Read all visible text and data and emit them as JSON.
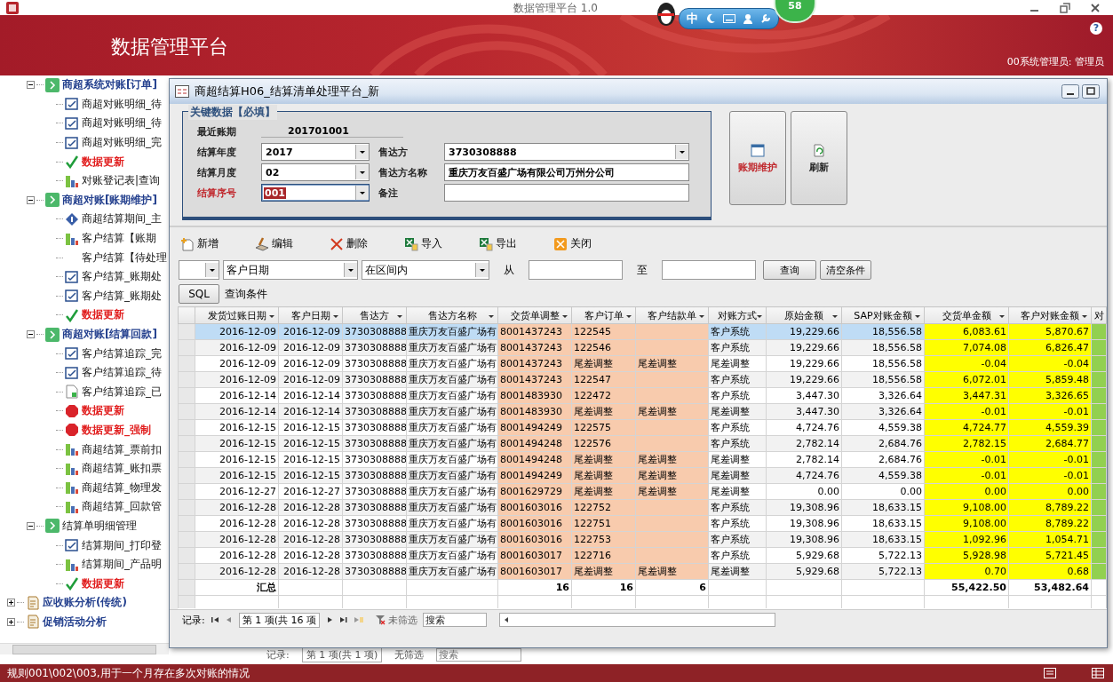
{
  "app_title": "数据管理平台 1.0",
  "tray": {
    "ime": "中",
    "badge": "58"
  },
  "banner": {
    "title": "数据管理平台",
    "help": "?",
    "user": "00系统管理员: 管理员"
  },
  "nav_tree": [
    {
      "kind": "continuation",
      "children": [
        {
          "label": "商超系统对账[订单]",
          "kind": "group",
          "expanded": true,
          "children": [
            {
              "label": "商超对账明细_待",
              "kind": "form"
            },
            {
              "label": "商超对账明细_待",
              "kind": "form"
            },
            {
              "label": "商超对账明细_完",
              "kind": "form"
            },
            {
              "label": "数据更新",
              "kind": "check"
            },
            {
              "label": "对账登记表|查询",
              "kind": "report"
            }
          ]
        },
        {
          "label": "商超对账[账期维护]",
          "kind": "group",
          "expanded": true,
          "children": [
            {
              "label": "商超结算期间_主",
              "kind": "info"
            },
            {
              "label": "客户结算【账期",
              "kind": "report"
            },
            {
              "label": "客户结算【待处理",
              "kind": "plain"
            },
            {
              "label": "客户结算_账期处",
              "kind": "form"
            },
            {
              "label": "客户结算_账期处",
              "kind": "form"
            },
            {
              "label": "数据更新",
              "kind": "check"
            }
          ]
        },
        {
          "label": "商超对账[结算回款]",
          "kind": "group",
          "expanded": true,
          "children": [
            {
              "label": "客户结算追踪_完",
              "kind": "form"
            },
            {
              "label": "客户结算追踪_待",
              "kind": "form"
            },
            {
              "label": "客户结算追踪_已",
              "kind": "doc"
            },
            {
              "label": "数据更新",
              "kind": "stop"
            },
            {
              "label": "数据更新_强制",
              "kind": "stop"
            },
            {
              "label": "商超结算_票前扣",
              "kind": "report"
            },
            {
              "label": "商超结算_账扣票",
              "kind": "report"
            },
            {
              "label": "商超结算_物理发",
              "kind": "report"
            },
            {
              "label": "商超结算_回款管",
              "kind": "report"
            }
          ]
        },
        {
          "label": "结算单明细管理",
          "kind": "subgroup",
          "expanded": true,
          "children": [
            {
              "label": "结算期间_打印登",
              "kind": "form"
            },
            {
              "label": "结算期间_产品明",
              "kind": "report"
            },
            {
              "label": "数据更新",
              "kind": "check"
            }
          ]
        }
      ]
    },
    {
      "label": "应收账分析(传统)",
      "kind": "module",
      "expanded": false
    },
    {
      "label": "促销活动分析",
      "kind": "module",
      "expanded": false
    }
  ],
  "dialog": {
    "title": "商超结算H06_结算清单处理平台_新",
    "key_data": {
      "legend": "关键数据【必填】",
      "rows": [
        [
          {
            "label": "最近账期",
            "value": "201701001",
            "kind": "static"
          }
        ],
        [
          {
            "label": "结算年度",
            "value": "2017",
            "kind": "combo",
            "active": false
          },
          {
            "label": "售达方",
            "value": "3730308888",
            "kind": "combo",
            "active": false
          }
        ],
        [
          {
            "label": "结算月度",
            "value": "02",
            "kind": "combo",
            "active": false
          },
          {
            "label": "售达方名称",
            "value": "重庆万友百盛广场有限公司万州分公司",
            "kind": "text",
            "active": false
          }
        ],
        [
          {
            "label": "结算序号",
            "value": "001",
            "kind": "combo",
            "active": true
          },
          {
            "label": "备注",
            "kind": "text",
            "active": false
          }
        ]
      ]
    },
    "side_buttons": [
      {
        "label": "账期维护",
        "kind": "calendar"
      },
      {
        "label": "刷新",
        "kind": "refresh"
      }
    ],
    "toolbar": [
      {
        "label": "新增",
        "kind": "new"
      },
      {
        "label": "编辑",
        "kind": "edit"
      },
      {
        "label": "删除",
        "kind": "delete"
      },
      {
        "label": "导入",
        "kind": "import"
      },
      {
        "label": "导出",
        "kind": "export"
      },
      {
        "label": "关闭",
        "kind": "close"
      }
    ],
    "filter": {
      "field": "客户日期",
      "operator": "在区间内",
      "from_label": "从",
      "to_label": "至",
      "query_button": "查询",
      "clear_button": "清空条件"
    },
    "sql": {
      "button": "SQL",
      "label": "查询条件"
    },
    "table": {
      "columns": [
        {
          "label": "发货过账日期",
          "total": "汇总"
        },
        {
          "label": "客户日期"
        },
        {
          "label": "售达方"
        },
        {
          "label": "售达方名称"
        },
        {
          "label": "交货单调整",
          "color": "#f8cbad",
          "total": "16"
        },
        {
          "label": "客户订单",
          "color": "#f8cbad",
          "total": "16"
        },
        {
          "label": "客户结款单",
          "color": "#f8cbad",
          "total": "6"
        },
        {
          "label": "对账方式"
        },
        {
          "label": "原始金额"
        },
        {
          "label": "SAP对账金额"
        },
        {
          "label": "交货单金额",
          "color": "#ffff00",
          "total": "55,422.50"
        },
        {
          "label": "客户对账金额",
          "color": "#ffff00",
          "total": "53,482.64"
        },
        {
          "label": "对",
          "color": "#92d050"
        }
      ],
      "rows": [
        {
          "selected": true,
          "cells": [
            "2016-12-09",
            "2016-12-09",
            "3730308888",
            "重庆万友百盛广场有",
            "8001437243",
            "122545",
            null,
            "客户系统",
            "19,229.66",
            "18,556.58",
            "6,083.61",
            "5,870.67"
          ]
        },
        {
          "selected": false,
          "cells": [
            "2016-12-09",
            "2016-12-09",
            "3730308888",
            "重庆万友百盛广场有",
            "8001437243",
            "122546",
            null,
            "客户系统",
            "19,229.66",
            "18,556.58",
            "7,074.08",
            "6,826.47"
          ]
        },
        {
          "selected": false,
          "cells": [
            "2016-12-09",
            "2016-12-09",
            "3730308888",
            "重庆万友百盛广场有",
            "8001437243",
            "尾差调整",
            "尾差调整",
            "尾差调整",
            "19,229.66",
            "18,556.58",
            "-0.04",
            "-0.04"
          ]
        },
        {
          "selected": false,
          "cells": [
            "2016-12-09",
            "2016-12-09",
            "3730308888",
            "重庆万友百盛广场有",
            "8001437243",
            "122547",
            null,
            "客户系统",
            "19,229.66",
            "18,556.58",
            "6,072.01",
            "5,859.48"
          ]
        },
        {
          "selected": false,
          "cells": [
            "2016-12-14",
            "2016-12-14",
            "3730308888",
            "重庆万友百盛广场有",
            "8001483930",
            "122472",
            null,
            "客户系统",
            "3,447.30",
            "3,326.64",
            "3,447.31",
            "3,326.65"
          ]
        },
        {
          "selected": false,
          "cells": [
            "2016-12-14",
            "2016-12-14",
            "3730308888",
            "重庆万友百盛广场有",
            "8001483930",
            "尾差调整",
            "尾差调整",
            "尾差调整",
            "3,447.30",
            "3,326.64",
            "-0.01",
            "-0.01"
          ]
        },
        {
          "selected": false,
          "cells": [
            "2016-12-15",
            "2016-12-15",
            "3730308888",
            "重庆万友百盛广场有",
            "8001494249",
            "122575",
            null,
            "客户系统",
            "4,724.76",
            "4,559.38",
            "4,724.77",
            "4,559.39"
          ]
        },
        {
          "selected": false,
          "cells": [
            "2016-12-15",
            "2016-12-15",
            "3730308888",
            "重庆万友百盛广场有",
            "8001494248",
            "122576",
            null,
            "客户系统",
            "2,782.14",
            "2,684.76",
            "2,782.15",
            "2,684.77"
          ]
        },
        {
          "selected": false,
          "cells": [
            "2016-12-15",
            "2016-12-15",
            "3730308888",
            "重庆万友百盛广场有",
            "8001494248",
            "尾差调整",
            "尾差调整",
            "尾差调整",
            "2,782.14",
            "2,684.76",
            "-0.01",
            "-0.01"
          ]
        },
        {
          "selected": false,
          "cells": [
            "2016-12-15",
            "2016-12-15",
            "3730308888",
            "重庆万友百盛广场有",
            "8001494249",
            "尾差调整",
            "尾差调整",
            "尾差调整",
            "4,724.76",
            "4,559.38",
            "-0.01",
            "-0.01"
          ]
        },
        {
          "selected": false,
          "cells": [
            "2016-12-27",
            "2016-12-27",
            "3730308888",
            "重庆万友百盛广场有",
            "8001629729",
            "尾差调整",
            "尾差调整",
            "尾差调整",
            "0.00",
            "0.00",
            "0.00",
            "0.00"
          ]
        },
        {
          "selected": false,
          "cells": [
            "2016-12-28",
            "2016-12-28",
            "3730308888",
            "重庆万友百盛广场有",
            "8001603016",
            "122752",
            null,
            "客户系统",
            "19,308.96",
            "18,633.15",
            "9,108.00",
            "8,789.22"
          ]
        },
        {
          "selected": false,
          "cells": [
            "2016-12-28",
            "2016-12-28",
            "3730308888",
            "重庆万友百盛广场有",
            "8001603016",
            "122751",
            null,
            "客户系统",
            "19,308.96",
            "18,633.15",
            "9,108.00",
            "8,789.22"
          ]
        },
        {
          "selected": false,
          "cells": [
            "2016-12-28",
            "2016-12-28",
            "3730308888",
            "重庆万友百盛广场有",
            "8001603016",
            "122753",
            null,
            "客户系统",
            "19,308.96",
            "18,633.15",
            "1,092.96",
            "1,054.71"
          ]
        },
        {
          "selected": false,
          "cells": [
            "2016-12-28",
            "2016-12-28",
            "3730308888",
            "重庆万友百盛广场有",
            "8001603017",
            "122716",
            null,
            "客户系统",
            "5,929.68",
            "5,722.13",
            "5,928.98",
            "5,721.45"
          ]
        },
        {
          "selected": false,
          "cells": [
            "2016-12-28",
            "2016-12-28",
            "3730308888",
            "重庆万友百盛广场有",
            "8001603017",
            "尾差调整",
            "尾差调整",
            "尾差调整",
            "5,929.68",
            "5,722.13",
            "0.70",
            "0.68"
          ]
        }
      ]
    },
    "record_nav": {
      "label": "记录:",
      "position": "第 1 项(共 16 项",
      "filter": "未筛选",
      "search_placeholder": "搜索"
    }
  },
  "background_nav": {
    "label": "记录:",
    "position": "第 1 项(共 1 项)",
    "filter": "无筛选",
    "search_placeholder": "搜索"
  },
  "status_bar": {
    "text": "规则001\\002\\003,用于一个月存在多次对账的情况"
  }
}
